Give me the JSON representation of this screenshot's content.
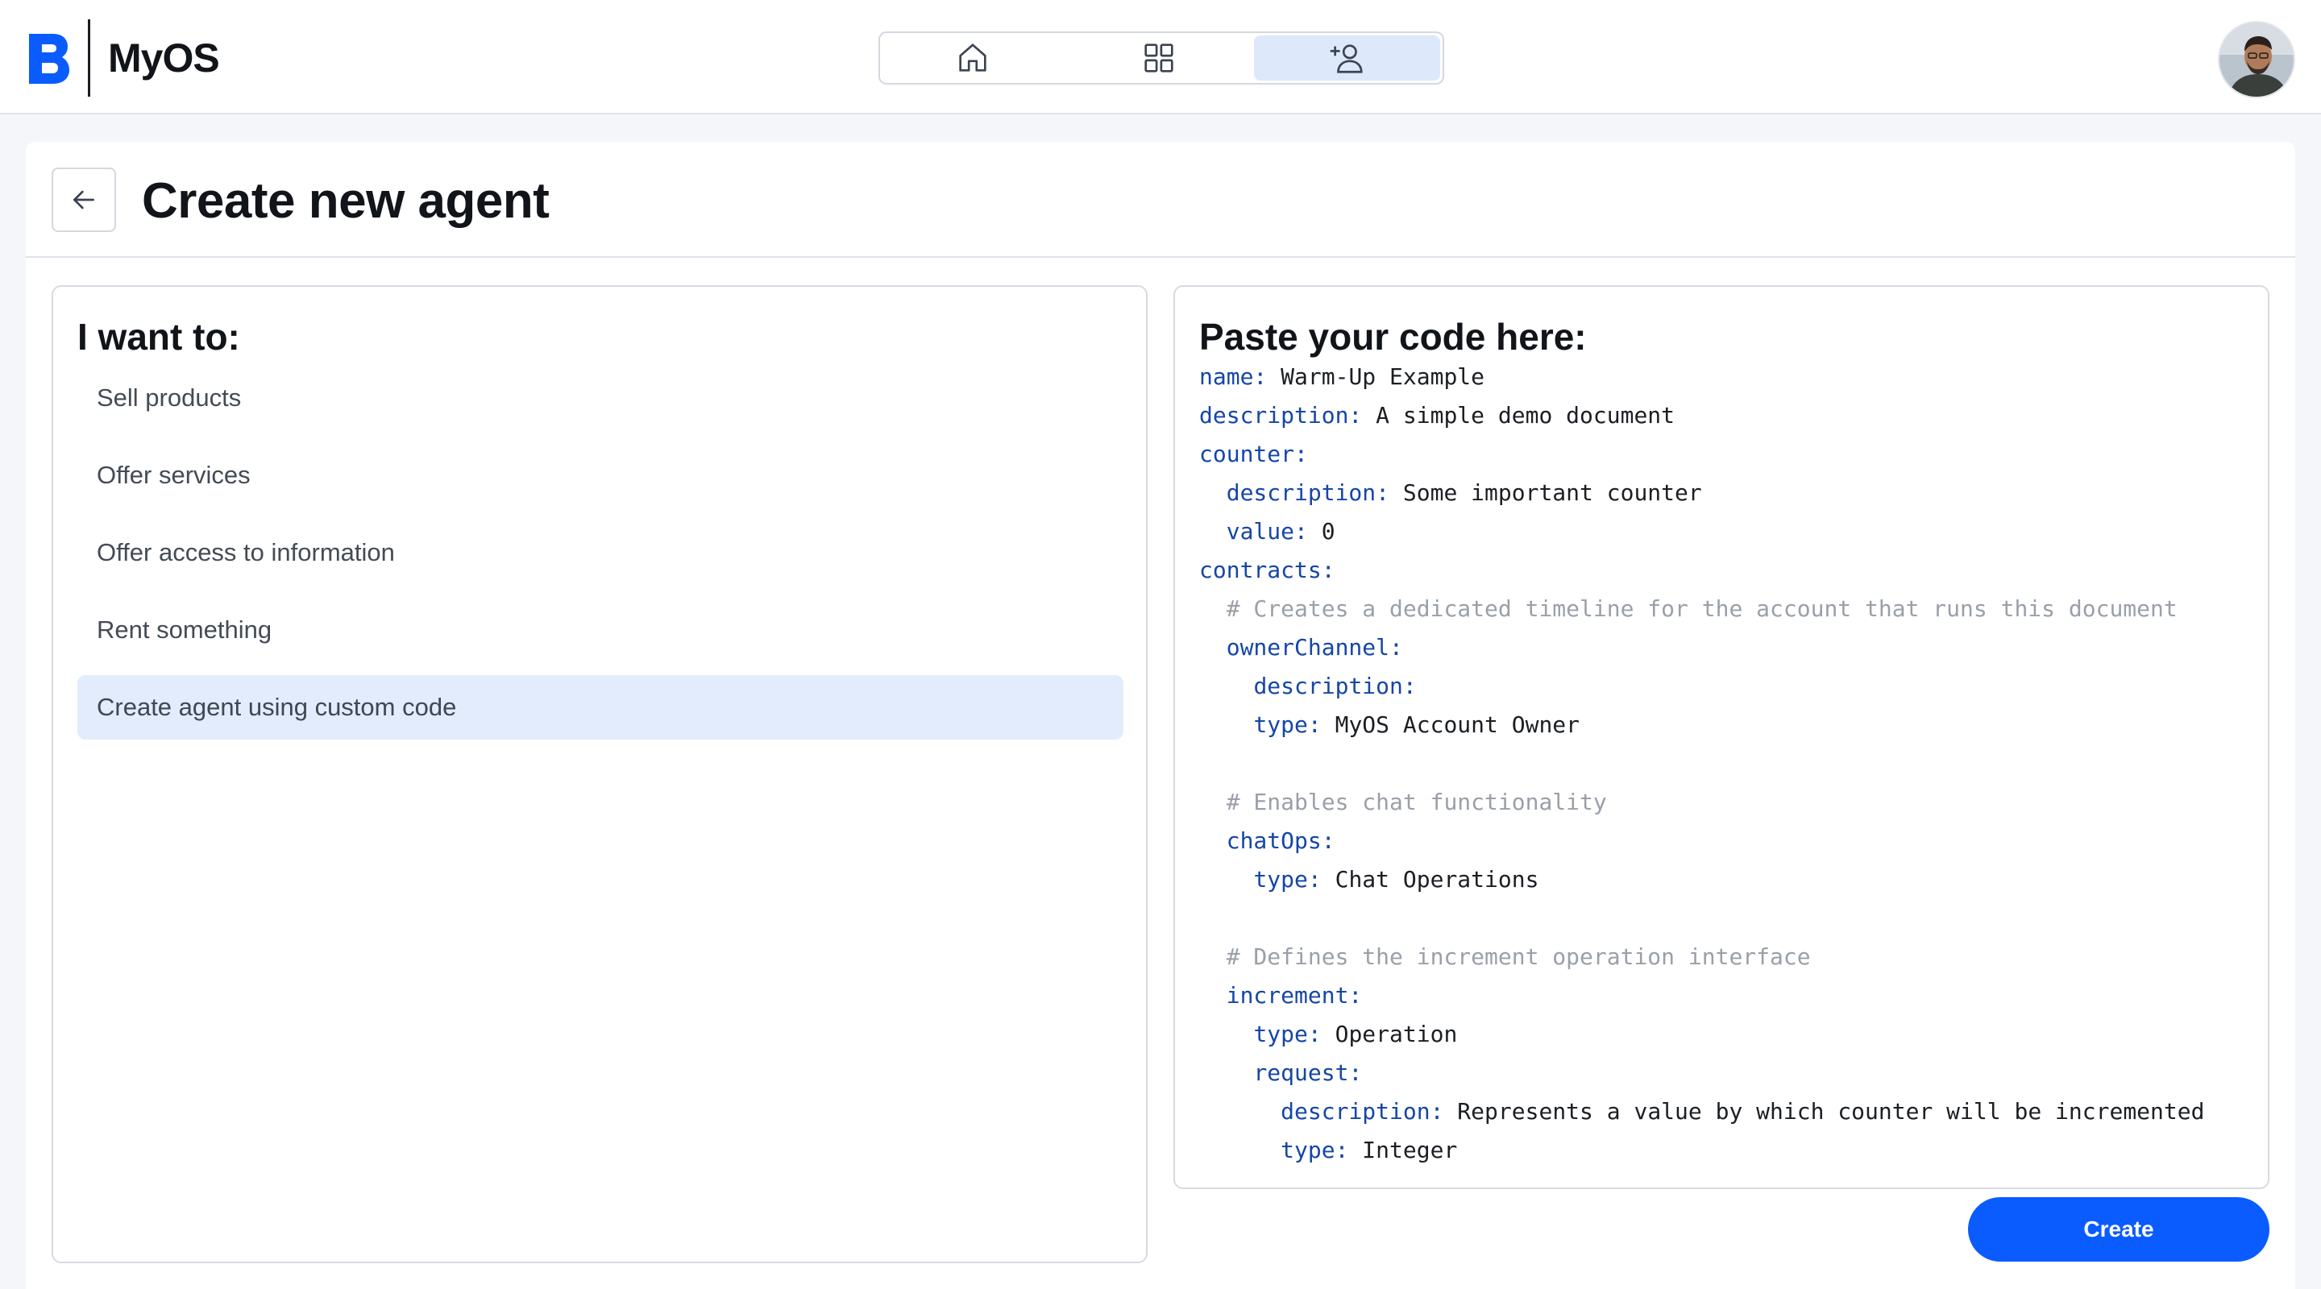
{
  "app": {
    "name": "MyOS",
    "brand_color": "#0a5cff"
  },
  "nav": {
    "items": [
      {
        "icon": "home-icon",
        "active": false
      },
      {
        "icon": "grid-icon",
        "active": false
      },
      {
        "icon": "add-user-icon",
        "active": true
      }
    ]
  },
  "header": {
    "title": "Create new agent",
    "back_icon": "arrow-left-icon"
  },
  "left_panel": {
    "title": "I want to:",
    "options": [
      {
        "label": "Sell products",
        "selected": false
      },
      {
        "label": "Offer services",
        "selected": false
      },
      {
        "label": "Offer access to information",
        "selected": false
      },
      {
        "label": "Rent something",
        "selected": false
      },
      {
        "label": "Create agent using custom code",
        "selected": true
      }
    ]
  },
  "right_panel": {
    "title": "Paste your code here:",
    "code_lines": [
      {
        "indent": "",
        "key": "name:",
        "value": " Warm-Up Example"
      },
      {
        "indent": "",
        "key": "description:",
        "value": " A simple demo document"
      },
      {
        "indent": "",
        "key": "counter:",
        "value": ""
      },
      {
        "indent": "  ",
        "key": "description:",
        "value": " Some important counter"
      },
      {
        "indent": "  ",
        "key": "value:",
        "value": " 0"
      },
      {
        "indent": "",
        "key": "contracts:",
        "value": ""
      },
      {
        "indent": "  ",
        "comment": "# Creates a dedicated timeline for the account that runs this document"
      },
      {
        "indent": "  ",
        "key": "ownerChannel:",
        "value": ""
      },
      {
        "indent": "    ",
        "key": "description:",
        "value": ""
      },
      {
        "indent": "    ",
        "key": "type:",
        "value": " MyOS Account Owner"
      },
      {
        "indent": "",
        "blank": true
      },
      {
        "indent": "  ",
        "comment": "# Enables chat functionality"
      },
      {
        "indent": "  ",
        "key": "chatOps:",
        "value": ""
      },
      {
        "indent": "    ",
        "key": "type:",
        "value": " Chat Operations"
      },
      {
        "indent": "",
        "blank": true
      },
      {
        "indent": "  ",
        "comment": "# Defines the increment operation interface"
      },
      {
        "indent": "  ",
        "key": "increment:",
        "value": ""
      },
      {
        "indent": "    ",
        "key": "type:",
        "value": " Operation"
      },
      {
        "indent": "    ",
        "key": "request:",
        "value": ""
      },
      {
        "indent": "      ",
        "key": "description:",
        "value": " Represents a value by which counter will be incremented"
      },
      {
        "indent": "      ",
        "key": "type:",
        "value": " Integer"
      }
    ]
  },
  "actions": {
    "create_label": "Create"
  },
  "colors": {
    "code_key": "#1546a8",
    "code_comment": "#9aa0a8",
    "selected_bg": "#e2ecfc"
  }
}
